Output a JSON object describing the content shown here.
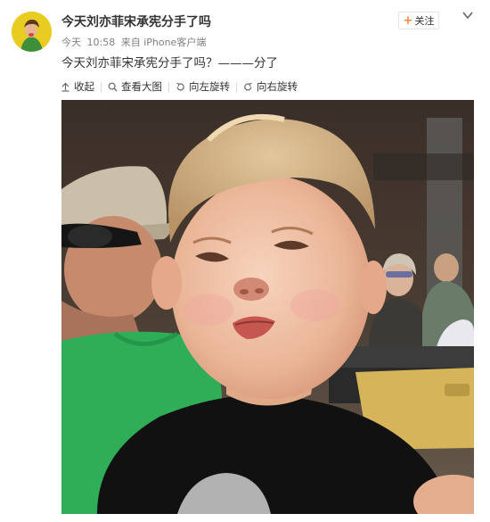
{
  "post": {
    "username": "今天刘亦菲宋承宪分手了吗",
    "meta_day": "今天",
    "meta_time": "10:58",
    "meta_source": "来自 iPhone客户端",
    "text": "今天刘亦菲宋承宪分手了吗？———分了"
  },
  "follow_button": {
    "plus": "+",
    "label": "关注"
  },
  "toolbar": {
    "collapse_label": "收起",
    "view_large_label": "查看大图",
    "rotate_left_label": "向左旋转",
    "rotate_right_label": "向右旋转"
  },
  "icons": {
    "collapse": "collapse-arrow-icon",
    "view_large": "magnifier-icon",
    "rotate_left": "rotate-left-icon",
    "rotate_right": "rotate-right-icon",
    "menu": "chevron-down-icon"
  },
  "colors": {
    "follow_plus": "#ff8140",
    "meta_text": "#808080",
    "body_text": "#333333"
  }
}
